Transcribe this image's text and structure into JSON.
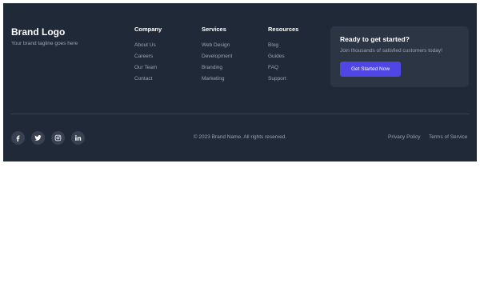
{
  "brand": {
    "logo": "Brand Logo",
    "tagline": "Your brand tagline goes here"
  },
  "columns": [
    {
      "title": "Company",
      "links": [
        "About Us",
        "Careers",
        "Our Team",
        "Contact"
      ]
    },
    {
      "title": "Services",
      "links": [
        "Web Design",
        "Development",
        "Branding",
        "Marketing"
      ]
    },
    {
      "title": "Resources",
      "links": [
        "Blog",
        "Guides",
        "FAQ",
        "Support"
      ]
    }
  ],
  "cta": {
    "title": "Ready to get started?",
    "subtitle": "Join thousands of satisfied customers today!",
    "button_label": "Get Started Now"
  },
  "social": [
    {
      "icon": "facebook-icon"
    },
    {
      "icon": "twitter-icon"
    },
    {
      "icon": "instagram-icon"
    },
    {
      "icon": "linkedin-icon"
    }
  ],
  "copyright": "© 2023 Brand Name. All rights reserved.",
  "legal_links": [
    "Privacy Policy",
    "Terms of Service"
  ],
  "colors": {
    "footer_bg": "#1f2937",
    "cta_bg": "#2c3544",
    "accent": "#4f46e5",
    "muted_text": "#9ca3af",
    "social_bg": "#374151"
  }
}
